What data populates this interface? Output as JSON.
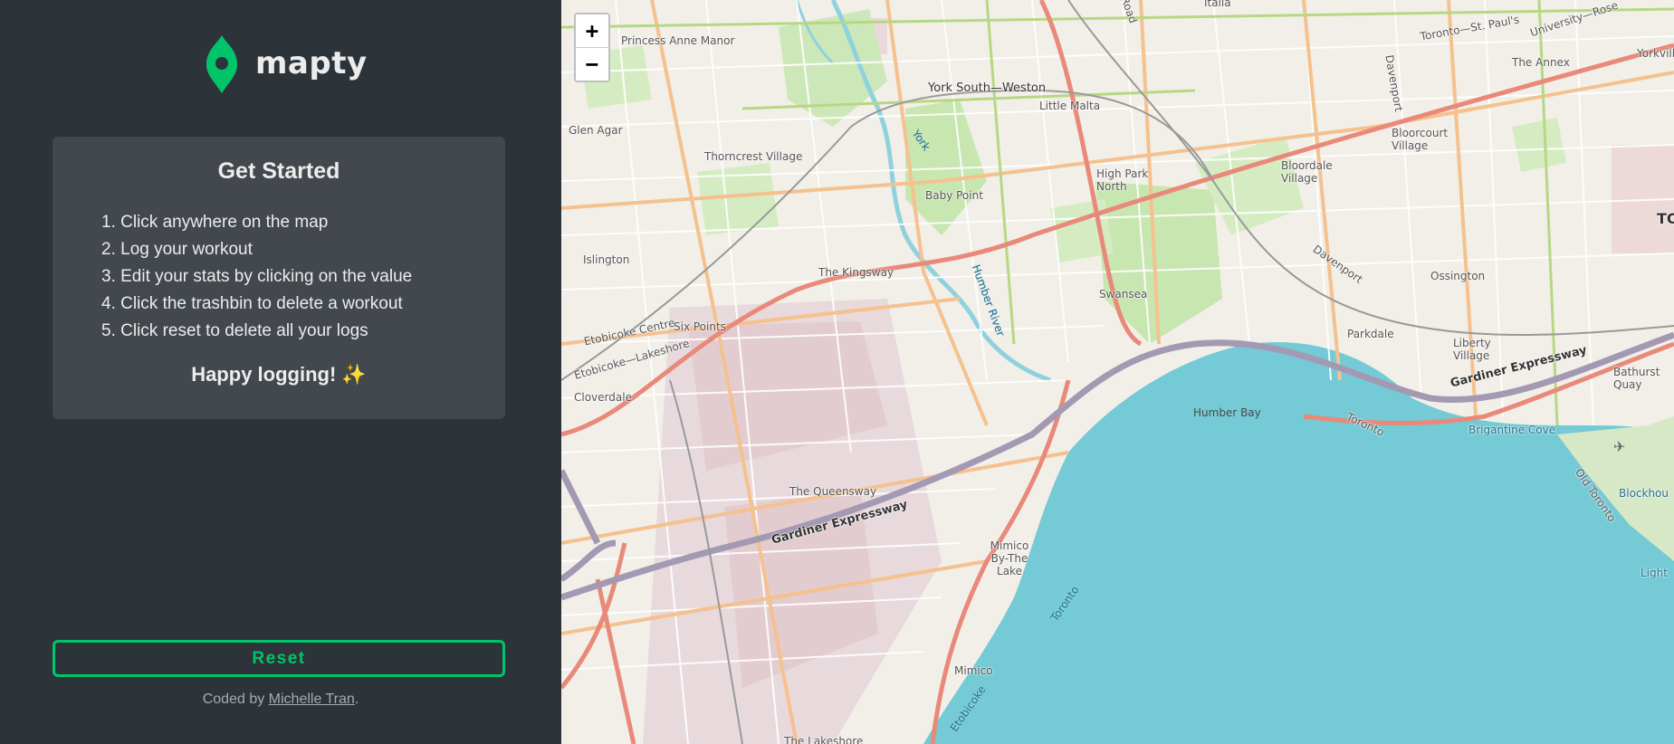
{
  "app": {
    "logo_text": "mapty",
    "brand_color": "#00c46a"
  },
  "card": {
    "title": "Get Started",
    "steps": [
      "1. Click anywhere on the map",
      "2. Log your workout",
      "3. Edit your stats by clicking on the value",
      "4. Click the trashbin to delete a workout",
      "5. Click reset to delete all your logs"
    ],
    "happy": "Happy logging! ✨"
  },
  "reset_label": "Reset",
  "footer": {
    "prefix": "Coded by ",
    "author": "Michelle Tran",
    "suffix": "."
  },
  "map": {
    "zoom_in": "+",
    "zoom_out": "−",
    "labels": {
      "princess_anne": "Princess Anne Manor",
      "glen_agar": "Glen Agar",
      "thorncrest": "Thorncrest Village",
      "york_south_weston": "York South—Weston",
      "little_malta": "Little Malta",
      "york": "York",
      "baby_point": "Baby Point",
      "high_park_north": "High Park North",
      "bloordale": "Bloordale Village",
      "bloorcourt": "Bloorcourt Village",
      "davenport": "Davenport",
      "davenport2": "Davenport",
      "the_annex": "The Annex",
      "yorkville": "Yorkvill",
      "toronto_st_pauls": "Toronto—St. Paul's",
      "university_rosedale": "University—Rose",
      "italia": "Italia",
      "islington": "Islington",
      "the_kingsway": "The Kingsway",
      "humber_river": "Humber River",
      "swansea": "Swansea",
      "ossington": "Ossington",
      "to": "TO",
      "etobicoke_centre": "Etobicoke Centre",
      "six_points": "Six Points",
      "etobicoke_lakeshore": "Etobicoke—Lakeshore",
      "parkdale": "Parkdale",
      "liberty_village": "Liberty Village",
      "bathurst_quay": "Bathurst Quay",
      "cloverdale": "Cloverdale",
      "humber_bay": "Humber Bay",
      "toronto_road": "Toronto",
      "brigantine_cove": "Brigantine Cove",
      "gardiner_top": "Gardiner Expressway",
      "gardiner_bottom": "Gardiner Expressway",
      "the_queensway": "The Queensway",
      "old_toronto": "Old Toronto",
      "blockhouse": "Blockhou",
      "mimico_by_the_lake": "Mimico By-The Lake",
      "toronto_water": "Toronto",
      "light": "Light",
      "mimico": "Mimico",
      "etobicoke_water": "Etobicoke",
      "the_lakeshore": "The Lakeshore",
      "road": "Road"
    }
  }
}
